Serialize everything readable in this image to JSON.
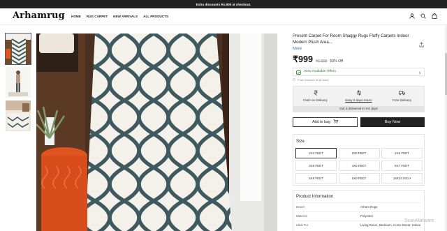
{
  "announcement": "Extra discounts Rs.900 at checkout.",
  "header": {
    "logo": "Arhamrug",
    "nav": [
      "HOME",
      "RUG CARPET",
      "NEW ARRIVALS",
      "ALL PRODUCTS"
    ],
    "icons": [
      "user-icon",
      "search-icon",
      "bag-icon"
    ]
  },
  "gallery": {
    "thumbnails": [
      "thumbnail-runner-rug",
      "thumbnail-rug-model",
      "thumbnail-room-rug"
    ],
    "selected_index": 0
  },
  "product": {
    "title": "Present Carpet For Room Shaggy Rugs Fluffy Carpets Indoor Modern Plush Area...",
    "more_link": "More",
    "price": "₹999",
    "mrp": "₹1,998",
    "discount": "50% Off",
    "offers_label": "View Available Offers",
    "tax_note": "Price inclusive of all taxes",
    "features": [
      "Cash on Delivery",
      "Easy 5 days return",
      "Free Delivery"
    ],
    "delivery_note": "Get it delivered in 3-6 days",
    "add_to_bag": "Add to bag",
    "buy_now": "Buy Now"
  },
  "size": {
    "title": "Size",
    "options": [
      "2X4 FEET",
      "2X5 FEET",
      "2X6 FEET",
      "3X5 FEET",
      "4X6 FEET",
      "5X7 FEET",
      "5X8 FEET",
      "6X9 FEET",
      "16X24 INCH"
    ],
    "selected": "2X4 FEET"
  },
  "product_information": {
    "title": "Product Information",
    "rows": [
      {
        "key": "Brand",
        "value": "Arham Rugs"
      },
      {
        "key": "Material",
        "value": "Polyester"
      },
      {
        "key": "Ideal For",
        "value": "Living Room, Bedroom, Home Decor, Indoor"
      }
    ]
  },
  "watermark": "ScanMalware",
  "colors": {
    "announcement_bg": "#222222",
    "button_dark": "#222222",
    "offer_green": "#2d7a2d",
    "link_blue": "#2b6cb0",
    "rug_pattern": "#3f5a5f",
    "rug_base": "#f4f1ea",
    "side_table": "#e0541f"
  }
}
